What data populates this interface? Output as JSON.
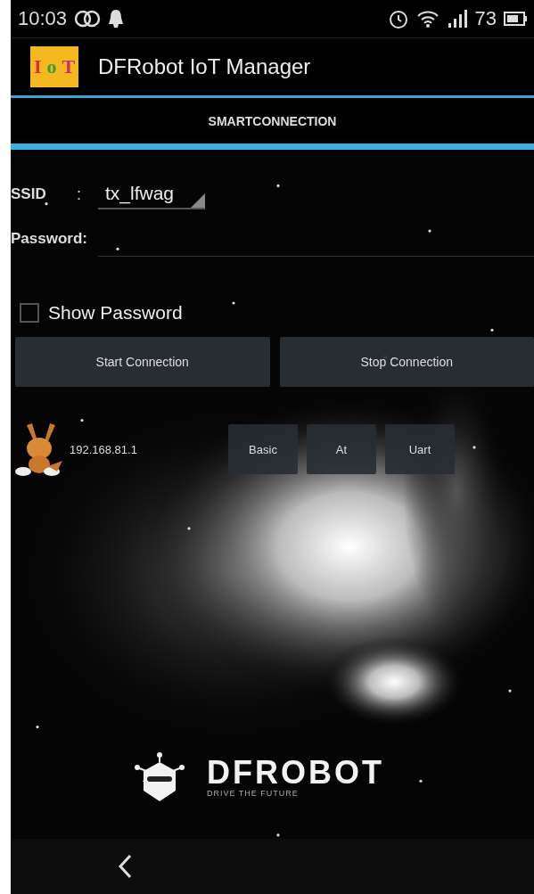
{
  "status_bar": {
    "time": "10:03",
    "battery": "73"
  },
  "app_bar": {
    "icon_letters": [
      {
        "text": "I",
        "color": "#d8323a"
      },
      {
        "text": "o",
        "color": "#3a9a3a"
      },
      {
        "text": "T",
        "color": "#c8326e"
      }
    ],
    "title": "DFRobot IoT Manager"
  },
  "tabs": [
    {
      "label": "SMARTCONNECTION",
      "selected": true
    }
  ],
  "form": {
    "ssid_label": "SSID",
    "separator": ":",
    "ssid_value": "tx_lfwag",
    "password_label": "Password:",
    "show_password": {
      "label": "Show Password",
      "checked": false
    }
  },
  "buttons": [
    "Start Connection",
    "Stop Connection"
  ],
  "devices": [
    {
      "address": "192.168.81.1",
      "actions": [
        "Basic",
        "At",
        "Uart"
      ]
    }
  ],
  "brand": {
    "name": "DFROBOT",
    "tagline": "DRIVE THE FUTURE"
  }
}
